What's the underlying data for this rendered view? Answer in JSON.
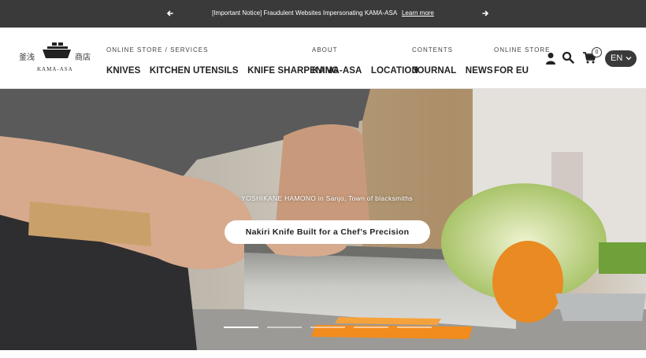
{
  "announcement": {
    "message": "[Important Notice] Fraudulent Websites Impersonating KAMA-ASA",
    "link_label": "Learn more"
  },
  "logo": {
    "kanji_left": "釜浅",
    "kanji_right": "商店",
    "roman": "KAMA-ASA"
  },
  "nav": [
    {
      "caption": "ONLINE STORE / SERVICES",
      "links": [
        "KNIVES",
        "KITCHEN UTENSILS",
        "KNIFE SHARPENING"
      ]
    },
    {
      "caption": "ABOUT",
      "links": [
        "KAMA-ASA",
        "LOCATION"
      ]
    },
    {
      "caption": "CONTENTS",
      "links": [
        "JOURNAL",
        "NEWS"
      ]
    },
    {
      "caption": "ONLINE STORE",
      "links": [
        "FOR EU"
      ]
    }
  ],
  "header_icons": [
    "user-icon",
    "search-icon",
    "cart-icon"
  ],
  "cart_count": "0",
  "language": "EN",
  "hero": {
    "subline": "YOSHIKANE HAMONO in Sanjo, Town of blacksmiths",
    "cta_label": "Nakiri Knife Built for a Chef’s Precision",
    "slide_count": 5,
    "active_slide": 1
  },
  "colors": {
    "announcement_bg": "#3a3a3a",
    "language_pill": "#3a3a3a",
    "text": "#222222"
  }
}
